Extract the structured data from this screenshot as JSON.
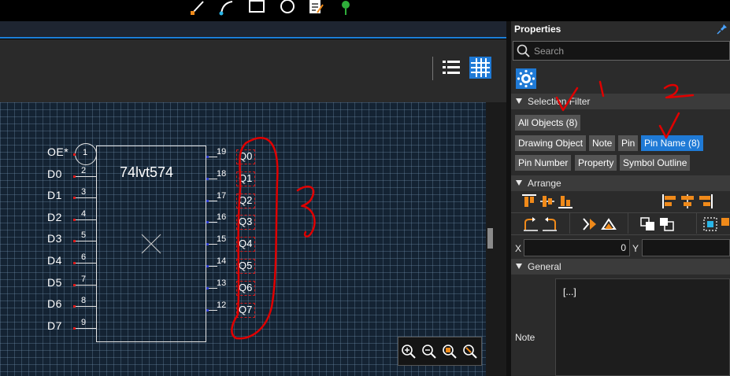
{
  "toolbar": {
    "tools": [
      {
        "icon": "line-icon"
      },
      {
        "icon": "arc-icon"
      },
      {
        "icon": "rectangle-icon"
      },
      {
        "icon": "circle-icon"
      },
      {
        "icon": "note-icon"
      },
      {
        "icon": "pin-tool-icon"
      }
    ]
  },
  "view": {
    "buttons": [
      {
        "icon": "list-view-icon",
        "active": false
      },
      {
        "icon": "grid-view-icon",
        "active": true
      }
    ]
  },
  "schematic": {
    "component_name": "74lvt574",
    "left_pins": [
      {
        "label": "OE*",
        "number": "1"
      },
      {
        "label": "D0",
        "number": "2"
      },
      {
        "label": "D1",
        "number": "3"
      },
      {
        "label": "D2",
        "number": "4"
      },
      {
        "label": "D3",
        "number": "5"
      },
      {
        "label": "D4",
        "number": "6"
      },
      {
        "label": "D5",
        "number": "7"
      },
      {
        "label": "D6",
        "number": "8"
      },
      {
        "label": "D7",
        "number": "9"
      }
    ],
    "right_pins": [
      {
        "label": "Q0",
        "number": "19"
      },
      {
        "label": "Q1",
        "number": "18"
      },
      {
        "label": "Q2",
        "number": "17"
      },
      {
        "label": "Q3",
        "number": "16"
      },
      {
        "label": "Q4",
        "number": "15"
      },
      {
        "label": "Q5",
        "number": "14"
      },
      {
        "label": "Q6",
        "number": "13"
      },
      {
        "label": "Q7",
        "number": "12"
      }
    ],
    "grid_color": "#142333",
    "selection_color": "#d01a1a"
  },
  "zoom": {
    "buttons": [
      "zoom-in-icon",
      "zoom-out-icon",
      "zoom-fit-icon",
      "zoom-selection-icon"
    ]
  },
  "properties": {
    "title": "Properties",
    "search_placeholder": "Search",
    "selection_filter": {
      "title": "Selection Filter",
      "chips": [
        {
          "label": "All Objects (8)",
          "active": false
        },
        {
          "label": "Drawing Object",
          "active": false
        },
        {
          "label": "Note",
          "active": false
        },
        {
          "label": "Pin",
          "active": false
        },
        {
          "label": "Pin Name (8)",
          "active": true
        },
        {
          "label": "Pin Number",
          "active": false
        },
        {
          "label": "Property",
          "active": false
        },
        {
          "label": "Symbol Outline",
          "active": false
        }
      ]
    },
    "arrange": {
      "title": "Arrange",
      "x_label": "X",
      "x_value": "0",
      "y_label": "Y",
      "y_value": ""
    },
    "general": {
      "title": "General",
      "note_label": "Note",
      "note_value": "[...]"
    }
  },
  "annotations": {
    "color": "#e00000",
    "marks": [
      "1",
      "2",
      "3"
    ]
  },
  "colors": {
    "accent": "#1f7ad6",
    "panel_bg": "#2b2b2b",
    "section_bg": "#3b3b3b"
  }
}
